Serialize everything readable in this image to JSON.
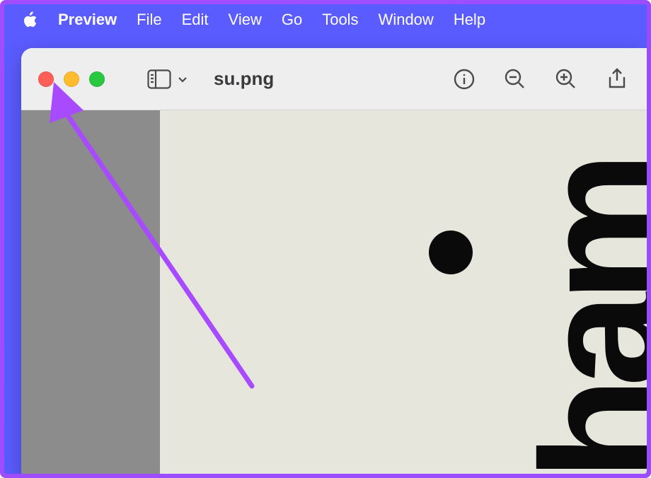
{
  "menubar": {
    "app": "Preview",
    "items": [
      "File",
      "Edit",
      "View",
      "Go",
      "Tools",
      "Window",
      "Help"
    ]
  },
  "window": {
    "filename": "su.png"
  },
  "canvas": {
    "rotated_text": "ham"
  },
  "colors": {
    "outer_border": "#a04dff",
    "menubar_bg": "#5b5cff",
    "arrow": "#a84bff"
  }
}
